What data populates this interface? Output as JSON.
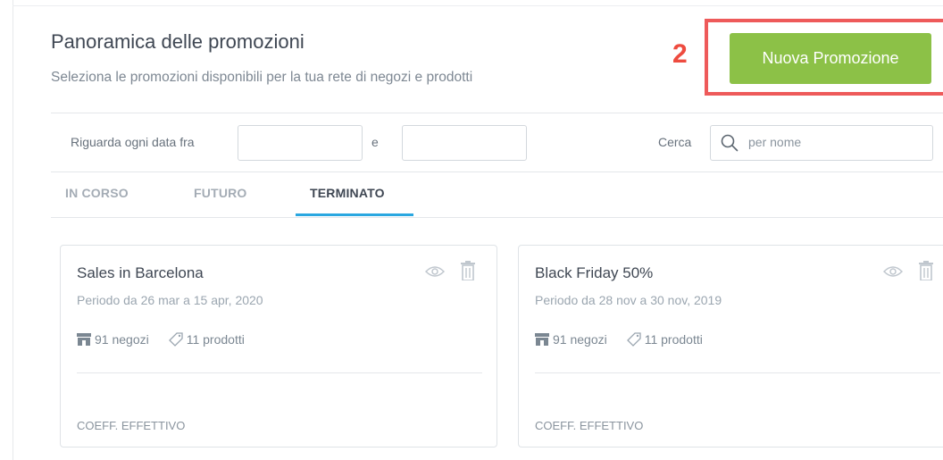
{
  "header": {
    "title": "Panoramica delle promozioni",
    "subtitle": "Seleziona le promozioni disponibili per la tua rete di negozi e prodotti",
    "new_button_label": "Nuova Promozione"
  },
  "annotation": {
    "number": "2",
    "color": "#ee4b3f"
  },
  "filters": {
    "date_label": "Riguarda ogni data fra",
    "and_label": "e",
    "date_from_value": "",
    "date_to_value": "",
    "search_label": "Cerca",
    "search_placeholder": "per nome"
  },
  "tabs": [
    {
      "label": "IN CORSO",
      "active": false
    },
    {
      "label": "FUTURO",
      "active": false
    },
    {
      "label": "TERMINATO",
      "active": true
    }
  ],
  "cards": [
    {
      "title": "Sales in Barcelona",
      "period": "Periodo da 26 mar a 15 apr, 2020",
      "stores": "91 negozi",
      "products": "11 prodotti",
      "coeff_label": "COEFF. EFFETTIVO"
    },
    {
      "title": "Black Friday 50%",
      "period": "Periodo da 28 nov a 30 nov, 2019",
      "stores": "91 negozi",
      "products": "11 prodotti",
      "coeff_label": "COEFF. EFFETTIVO"
    }
  ],
  "colors": {
    "primary_button": "#8cc147",
    "active_tab_underline": "#2aa7e0",
    "annotation_box": "#ee5a5a"
  }
}
